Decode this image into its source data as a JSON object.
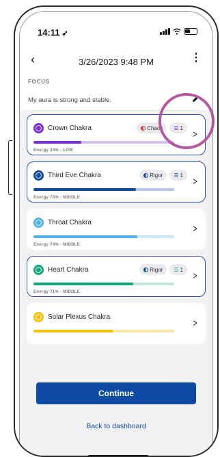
{
  "status_bar": {
    "time": "14:11",
    "location_arrow": "➶"
  },
  "header": {
    "title": "3/26/2023 9:48 PM",
    "back_icon": "‹",
    "menu_icon": "⋮"
  },
  "focus": {
    "label": "FOCUS",
    "text": "My aura is strong and stable."
  },
  "cards": [
    {
      "name": "Crown Chakra",
      "energy_text": "Energy 34% - LOW",
      "energy_fraction": 0.34,
      "color": "#7b2fd9",
      "track_color": "#d8c2f5",
      "selected": true,
      "chip_mode": {
        "label": "Chaos",
        "color": "#e0353a"
      },
      "chip_count": {
        "label": "1",
        "color": "#7b2fd9"
      }
    },
    {
      "name": "Third Eve Chakra",
      "energy_text": "Energy 73% - MIDDLE",
      "energy_fraction": 0.73,
      "color": "#0d4ba5",
      "track_color": "#b7c8e8",
      "selected": true,
      "chip_mode": {
        "label": "Rigor",
        "color": "#0d4ba5"
      },
      "chip_count": {
        "label": "1",
        "color": "#0d4ba5"
      }
    },
    {
      "name": "Throat Chakra",
      "energy_text": "Energy 74% - MIDDLE",
      "energy_fraction": 0.74,
      "color": "#4fb3ea",
      "track_color": "#c9e7f8",
      "selected": false
    },
    {
      "name": "Heart Chakra",
      "energy_text": "Energy 71% - MIDDLE",
      "energy_fraction": 0.71,
      "color": "#13a77a",
      "track_color": "#bfe6d8",
      "selected": true,
      "chip_mode": {
        "label": "Rigor",
        "color": "#0d4ba5"
      },
      "chip_count": {
        "label": "1",
        "color": "#13a77a"
      }
    },
    {
      "name": "Solar Plexus Chakra",
      "energy_text": "",
      "energy_fraction": 0.57,
      "color": "#f2c20c",
      "track_color": "#f8e9a8",
      "selected": false
    }
  ],
  "actions": {
    "continue_label": "Continue",
    "back_label": "Back to dashboard"
  },
  "colors": {
    "primary": "#0d4ba5",
    "highlight": "#b25aa0"
  }
}
